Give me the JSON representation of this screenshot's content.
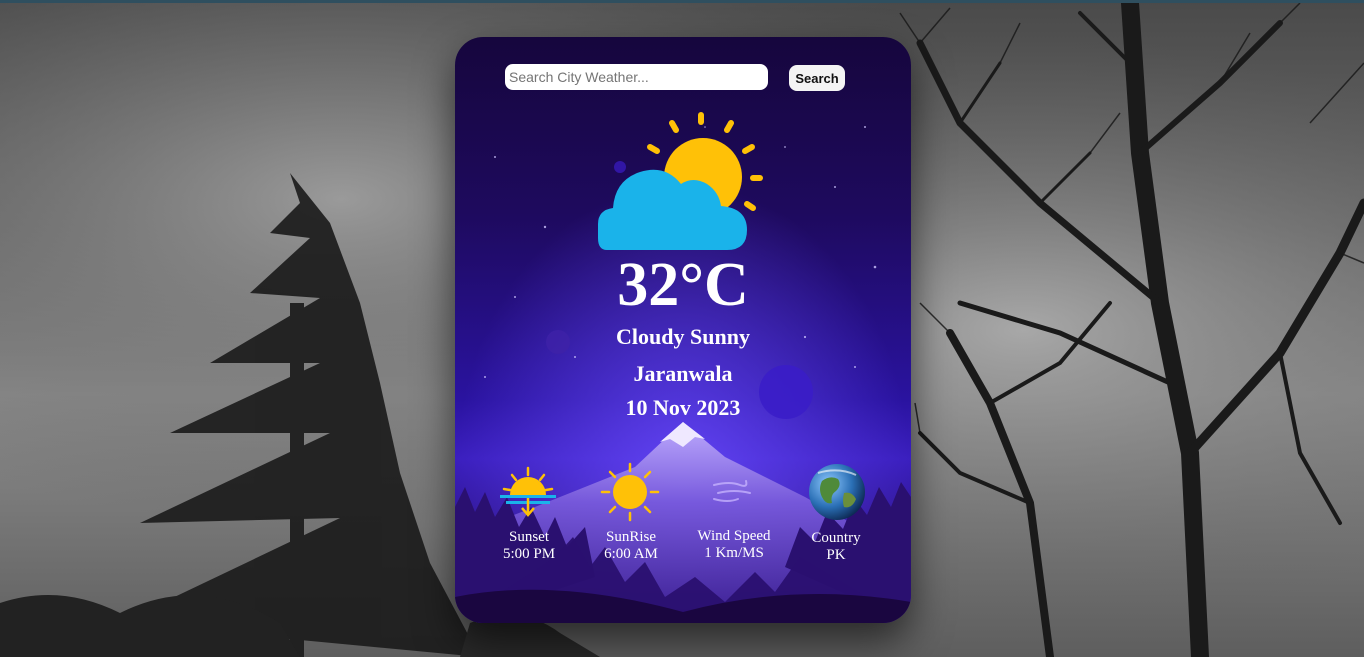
{
  "search": {
    "placeholder": "Search City Weather...",
    "button_label": "Search"
  },
  "weather": {
    "icon": "cloudy-sunny-icon",
    "temperature": "32°C",
    "condition": "Cloudy Sunny",
    "city": "Jaranwala",
    "date": "10 Nov 2023"
  },
  "stats": {
    "sunset": {
      "label": "Sunset",
      "value": "5:00 PM",
      "icon": "sunset-icon"
    },
    "sunrise": {
      "label": "SunRise",
      "value": "6:00 AM",
      "icon": "sun-icon"
    },
    "wind": {
      "label": "Wind Speed",
      "value": "1 Km/MS",
      "icon": "wind-icon"
    },
    "country": {
      "label": "Country",
      "value": "PK",
      "icon": "globe-icon"
    }
  },
  "colors": {
    "sun": "#ffc107",
    "cloud": "#1ab3ea",
    "card_top": "#16063d",
    "card_mid": "#2a13a0"
  }
}
